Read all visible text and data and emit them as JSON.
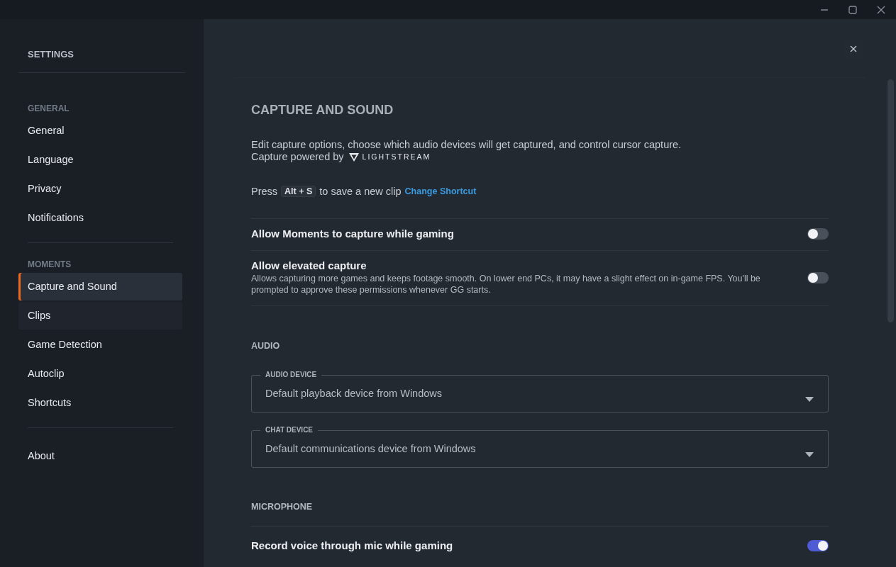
{
  "sidebar": {
    "title": "SETTINGS",
    "sections": [
      {
        "header": "GENERAL",
        "items": [
          {
            "label": "General",
            "selected": false
          },
          {
            "label": "Language",
            "selected": false
          },
          {
            "label": "Privacy",
            "selected": false
          },
          {
            "label": "Notifications",
            "selected": false
          }
        ]
      },
      {
        "header": "MOMENTS",
        "items": [
          {
            "label": "Capture and Sound",
            "selected": true
          },
          {
            "label": "Clips",
            "selected": false
          },
          {
            "label": "Game Detection",
            "selected": false
          },
          {
            "label": "Autoclip",
            "selected": false
          },
          {
            "label": "Shortcuts",
            "selected": false
          }
        ]
      },
      {
        "items": [
          {
            "label": "About",
            "selected": false
          }
        ]
      }
    ]
  },
  "page": {
    "title": "CAPTURE AND SOUND",
    "description": "Edit capture options, choose which audio devices will get captured, and control cursor capture.",
    "powered_by": "Capture powered by",
    "brand": "LIGHTSTREAM",
    "shortcut": {
      "before": "Press",
      "key": "Alt + S",
      "after": "to save a new clip",
      "link": "Change Shortcut"
    },
    "toggles": [
      {
        "title": "Allow Moments to capture while gaming",
        "on": false
      },
      {
        "title": "Allow elevated capture",
        "description": "Allows capturing more games and keeps footage smooth. On lower end PCs, it may have a slight effect on in-game FPS. You'll be prompted to approve these permissions whenever GG starts.",
        "on": false
      }
    ],
    "audio": {
      "header": "AUDIO",
      "fields": [
        {
          "label": "AUDIO DEVICE",
          "value": "Default playback device from Windows"
        },
        {
          "label": "CHAT DEVICE",
          "value": "Default communications device from Windows"
        }
      ]
    },
    "microphone": {
      "header": "MICROPHONE",
      "toggles": [
        {
          "title": "Record voice through mic while gaming",
          "on": true
        }
      ]
    }
  }
}
